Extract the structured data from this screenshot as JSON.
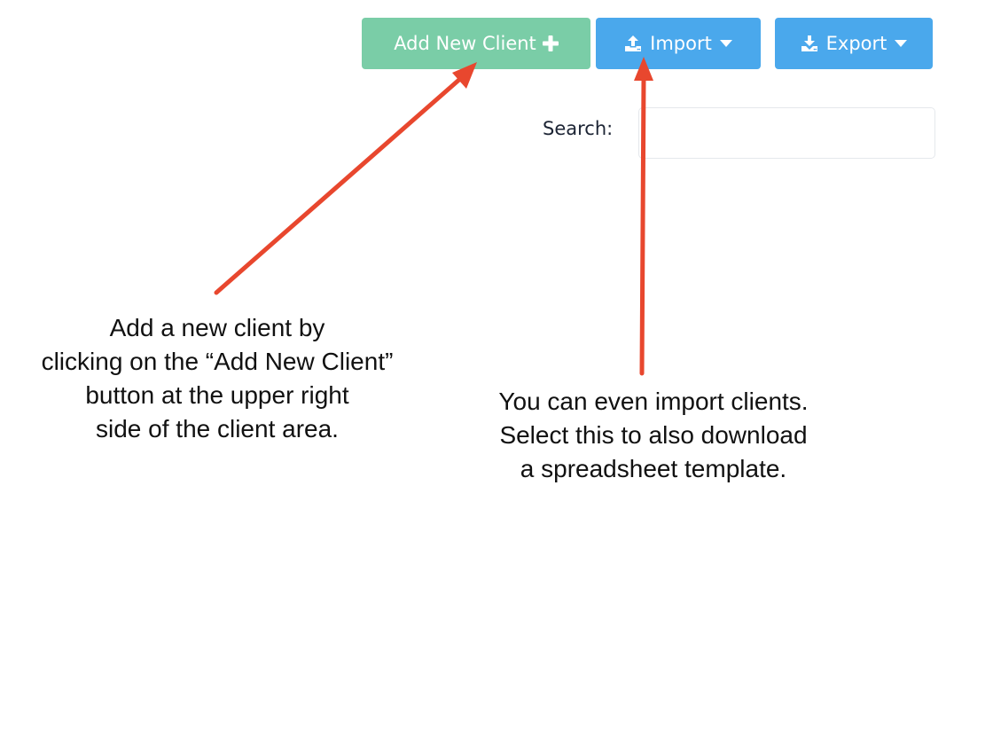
{
  "toolbar": {
    "add_client_label": "Add New Client",
    "import_label": "Import",
    "export_label": "Export"
  },
  "search": {
    "label": "Search:",
    "value": ""
  },
  "annotations": {
    "left_note": [
      "Add a new client by",
      "clicking on the “Add New Client”",
      "button at the upper right",
      "side of the client area."
    ],
    "right_note": [
      "You can even import clients.",
      "Select this to also download",
      "a spreadsheet template."
    ]
  },
  "colors": {
    "add_button": "#7acda7",
    "import_export_buttons": "#4aa8ec",
    "arrow": "#e8472e"
  },
  "icons": {
    "add_button": "plus-icon",
    "import_button": "upload-icon",
    "export_button": "download-icon",
    "dropdown": "caret-down-icon"
  }
}
